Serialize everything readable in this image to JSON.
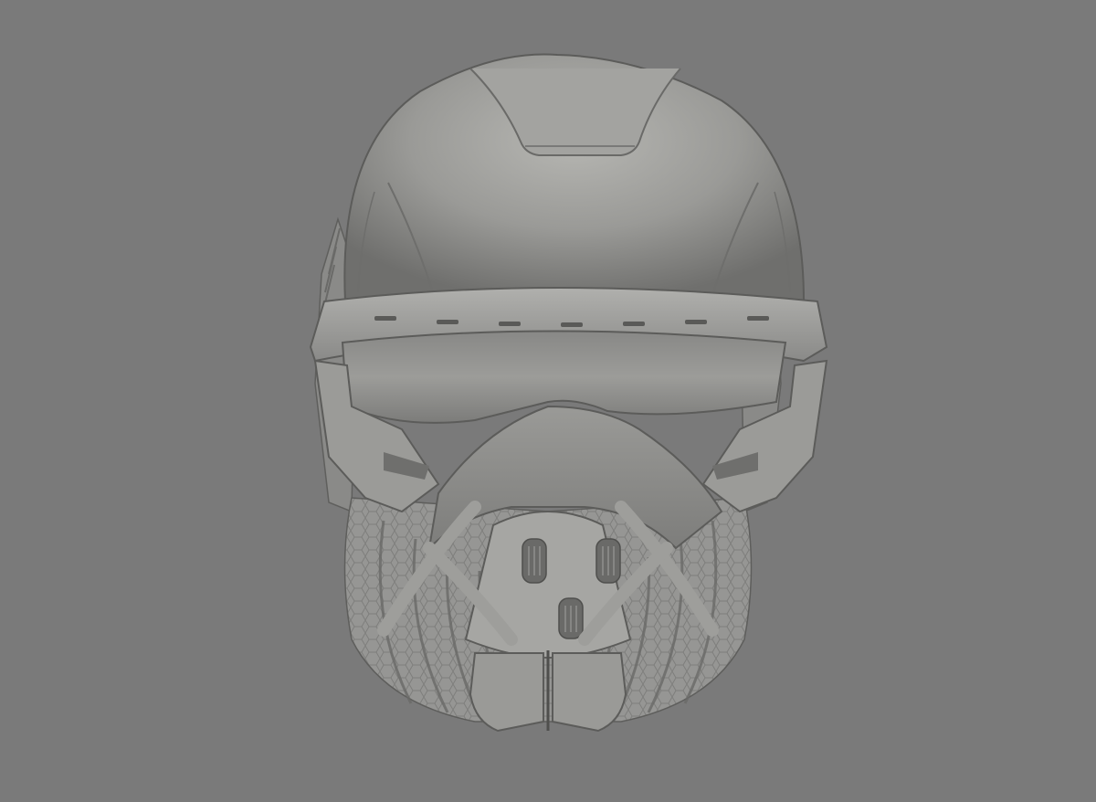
{
  "viewport": {
    "background_color": "#7a7a7a"
  },
  "model": {
    "subject": "helmet",
    "material_color": "#8e8e8e",
    "highlight_color": "#b4b4b4",
    "shadow_color": "#5a5a5a"
  }
}
